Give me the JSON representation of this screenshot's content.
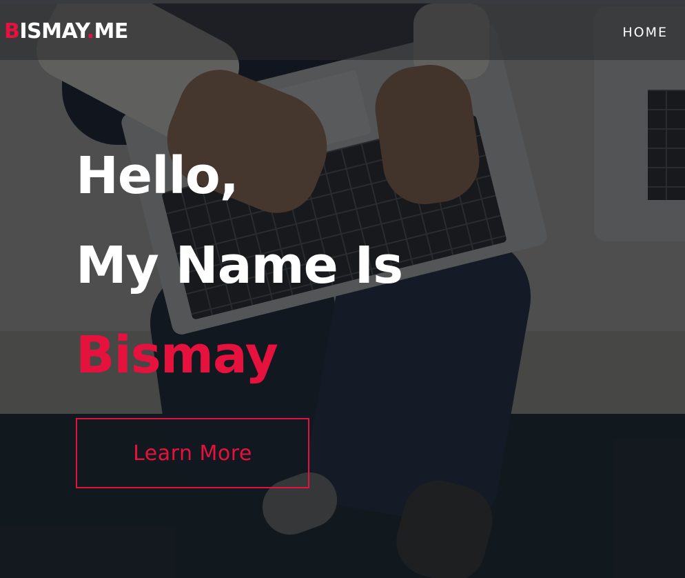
{
  "header": {
    "logo": {
      "first": "B",
      "main": "ISMAY",
      "dot": ".",
      "tld": "ME"
    },
    "nav": [
      {
        "label": "HOME"
      }
    ]
  },
  "hero": {
    "line1": "Hello,",
    "line2": "My Name Is",
    "name": "Bismay",
    "cta_label": "Learn More"
  },
  "colors": {
    "accent": "#e5123e",
    "text": "#ffffff",
    "header_bg": "rgba(40,40,44,0.55)"
  }
}
